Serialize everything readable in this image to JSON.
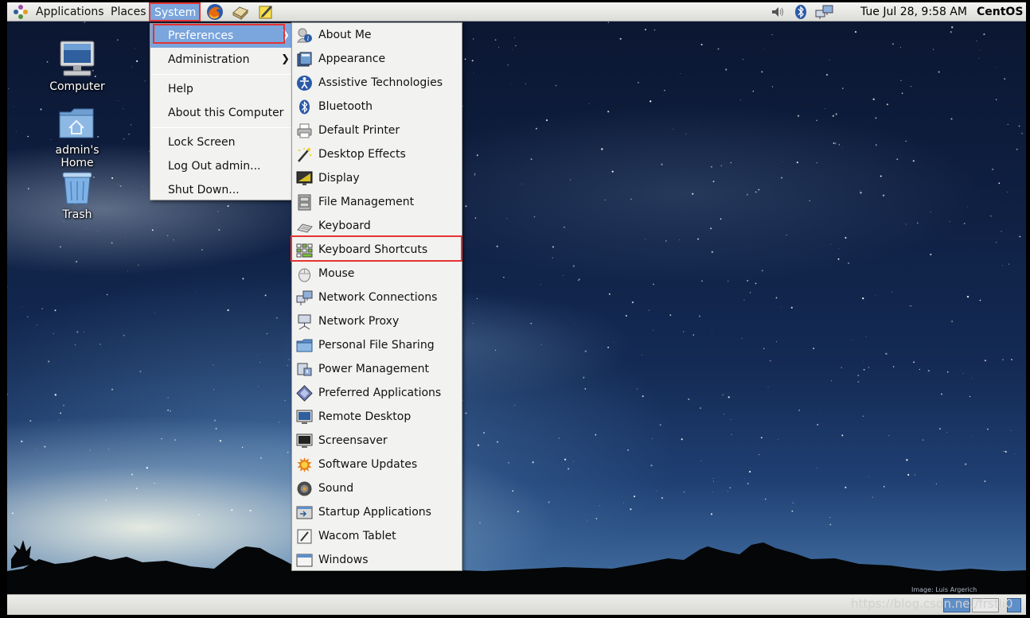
{
  "panel": {
    "menus": [
      "Applications",
      "Places",
      "System"
    ],
    "clock": "Tue Jul 28,  9:58 AM",
    "brand": "CentOS",
    "launcher_icons": [
      "firefox-icon",
      "mail-client-icon",
      "notes-icon"
    ],
    "tray_icons": [
      "volume-icon",
      "bluetooth-icon",
      "network-icon"
    ]
  },
  "desktop": {
    "icons": [
      {
        "label": "Computer",
        "icon": "computer-icon"
      },
      {
        "label": "admin's Home",
        "icon": "home-folder-icon"
      },
      {
        "label": "Trash",
        "icon": "trash-icon"
      }
    ]
  },
  "system_menu": {
    "items": [
      {
        "label": "Preferences",
        "submenu": true,
        "highlighted": true
      },
      {
        "label": "Administration",
        "submenu": true
      },
      {
        "label": "Help"
      },
      {
        "label": "About this Computer"
      },
      {
        "label": "Lock Screen"
      },
      {
        "label": "Log Out admin..."
      },
      {
        "label": "Shut Down..."
      }
    ]
  },
  "preferences_menu": {
    "items": [
      {
        "label": "About Me",
        "icon": "about-me-icon"
      },
      {
        "label": "Appearance",
        "icon": "appearance-icon"
      },
      {
        "label": "Assistive Technologies",
        "icon": "accessibility-icon"
      },
      {
        "label": "Bluetooth",
        "icon": "bluetooth-icon"
      },
      {
        "label": "Default Printer",
        "icon": "printer-icon"
      },
      {
        "label": "Desktop Effects",
        "icon": "desktop-effects-icon"
      },
      {
        "label": "Display",
        "icon": "display-icon"
      },
      {
        "label": "File Management",
        "icon": "file-management-icon"
      },
      {
        "label": "Keyboard",
        "icon": "keyboard-icon"
      },
      {
        "label": "Keyboard Shortcuts",
        "icon": "keyboard-shortcuts-icon",
        "highlighted_box": true
      },
      {
        "label": "Mouse",
        "icon": "mouse-icon"
      },
      {
        "label": "Network Connections",
        "icon": "network-connections-icon"
      },
      {
        "label": "Network Proxy",
        "icon": "network-proxy-icon"
      },
      {
        "label": "Personal File Sharing",
        "icon": "file-sharing-icon"
      },
      {
        "label": "Power Management",
        "icon": "power-management-icon"
      },
      {
        "label": "Preferred Applications",
        "icon": "preferred-applications-icon"
      },
      {
        "label": "Remote Desktop",
        "icon": "remote-desktop-icon"
      },
      {
        "label": "Screensaver",
        "icon": "screensaver-icon"
      },
      {
        "label": "Software Updates",
        "icon": "software-updates-icon"
      },
      {
        "label": "Sound",
        "icon": "sound-icon"
      },
      {
        "label": "Startup Applications",
        "icon": "startup-applications-icon"
      },
      {
        "label": "Wacom Tablet",
        "icon": "wacom-tablet-icon"
      },
      {
        "label": "Windows",
        "icon": "windows-icon"
      }
    ]
  },
  "wallpaper_credit": "Image: Luis Argerich",
  "watermark": "https://blog.csdn.net/frstli0"
}
